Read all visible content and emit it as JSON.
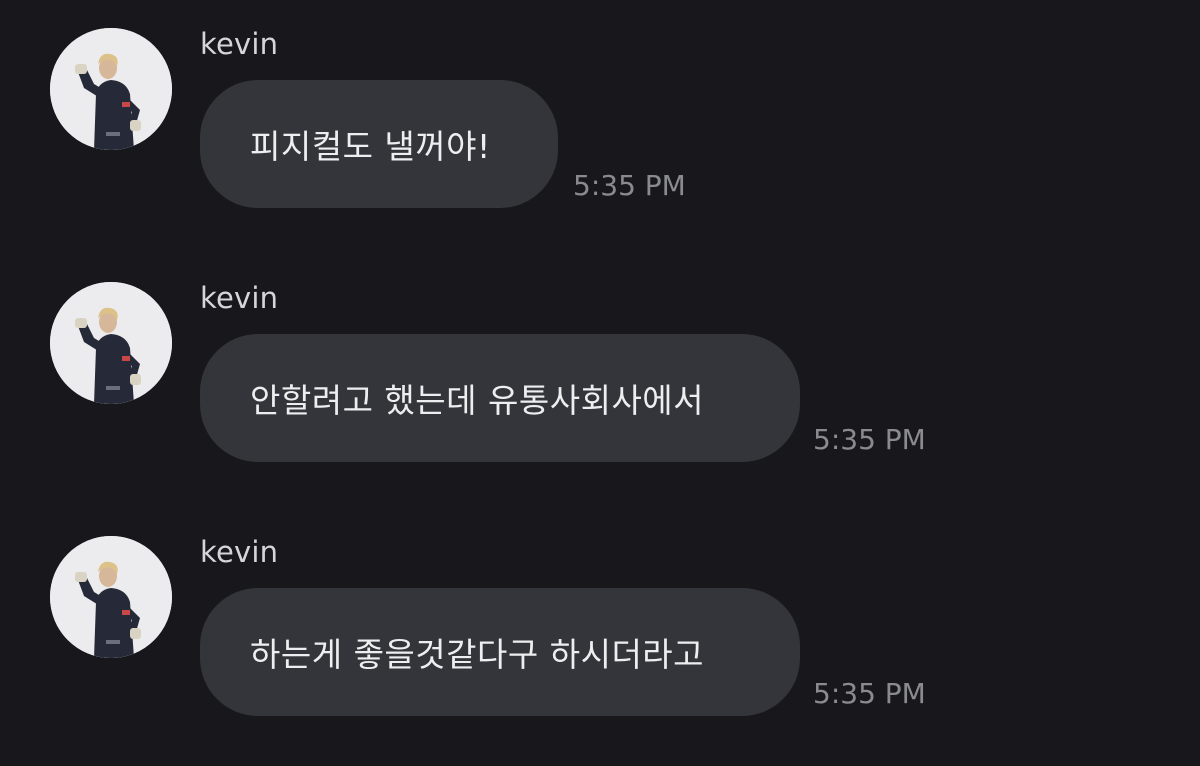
{
  "conversation": {
    "messages": [
      {
        "sender": "kevin",
        "text": "피지컬도 낼꺼야!",
        "time": "5:35 PM",
        "avatar_icon": "profile-photo"
      },
      {
        "sender": "kevin",
        "text": "안할려고 했는데 유통사회사에서",
        "time": "5:35 PM",
        "avatar_icon": "profile-photo"
      },
      {
        "sender": "kevin",
        "text": "하는게 좋을것같다구 하시더라고",
        "time": "5:35 PM",
        "avatar_icon": "profile-photo"
      }
    ]
  },
  "colors": {
    "background": "#18181c",
    "bubble": "#33353b",
    "sender": "#d6d6da",
    "message_text": "#eeeef0",
    "timestamp": "#8a8b91"
  }
}
